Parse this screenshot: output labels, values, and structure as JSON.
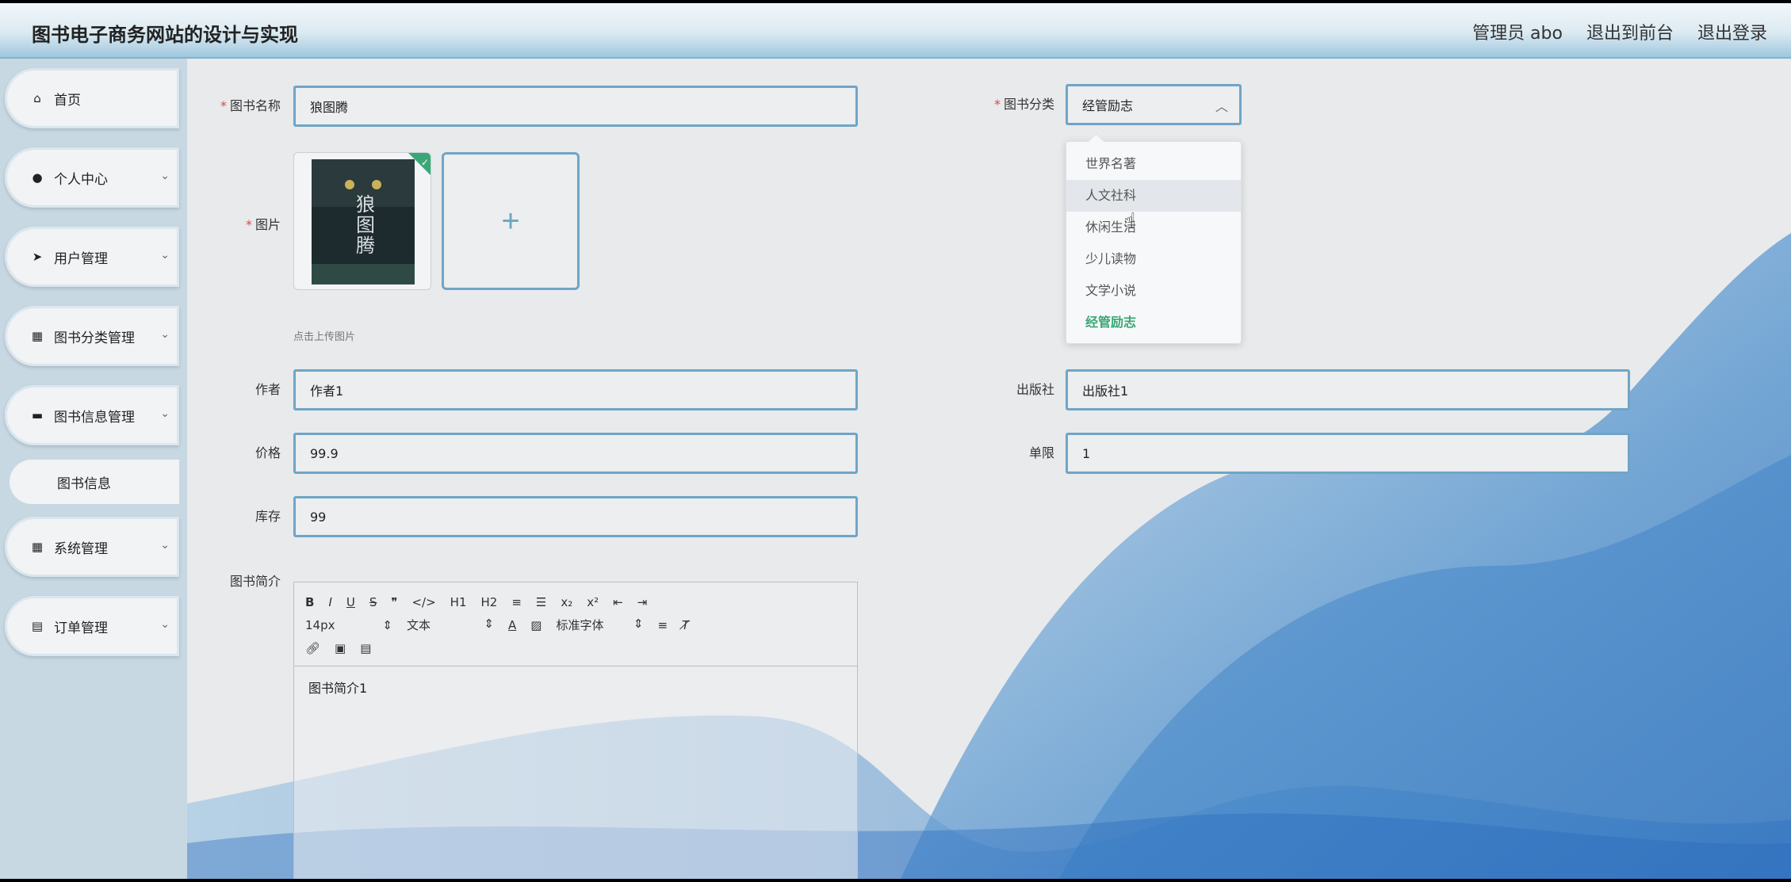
{
  "app": {
    "title": "图书电子商务网站的设计与实现"
  },
  "header": {
    "user": "管理员 abo",
    "front": "退出到前台",
    "logout": "退出登录"
  },
  "sidebar": {
    "items": [
      {
        "label": "首页",
        "icon": "home-icon"
      },
      {
        "label": "个人中心",
        "icon": "user-icon"
      },
      {
        "label": "用户管理",
        "icon": "send-icon"
      },
      {
        "label": "图书分类管理",
        "icon": "grid-icon"
      },
      {
        "label": "图书信息管理",
        "icon": "briefcase-icon"
      },
      {
        "label": "系统管理",
        "icon": "apps-icon"
      },
      {
        "label": "订单管理",
        "icon": "clipboard-icon"
      }
    ],
    "sub_item": "图书信息"
  },
  "form": {
    "name_label": "图书名称",
    "name_value": "狼图腾",
    "category_label": "图书分类",
    "category_value": "经管励志",
    "image_label": "图片",
    "image_hint": "点击上传图片",
    "cover_title": "狼图腾",
    "author_label": "作者",
    "author_value": "作者1",
    "publisher_label": "出版社",
    "publisher_value": "出版社1",
    "price_label": "价格",
    "price_value": "99.9",
    "limit_label": "单限",
    "limit_value": "1",
    "stock_label": "库存",
    "stock_value": "99",
    "intro_label": "图书简介",
    "intro_value": "图书简介1"
  },
  "dropdown": {
    "options": [
      "世界名著",
      "人文社科",
      "休闲生活",
      "少儿读物",
      "文学小说",
      "经管励志"
    ],
    "hovered": "人文社科",
    "selected": "经管励志"
  },
  "editor": {
    "row1": [
      "B",
      "I",
      "U",
      "S",
      "❞",
      "</>",
      "H1",
      "H2",
      "≡",
      "☰",
      "x₂",
      "x²",
      "⇤",
      "⇥"
    ],
    "font_size": "14px",
    "text_type": "文本",
    "font_family": "标准字体"
  },
  "colors": {
    "accent": "#6fa5c6",
    "selected": "#3aa776",
    "required": "#e2463f"
  }
}
